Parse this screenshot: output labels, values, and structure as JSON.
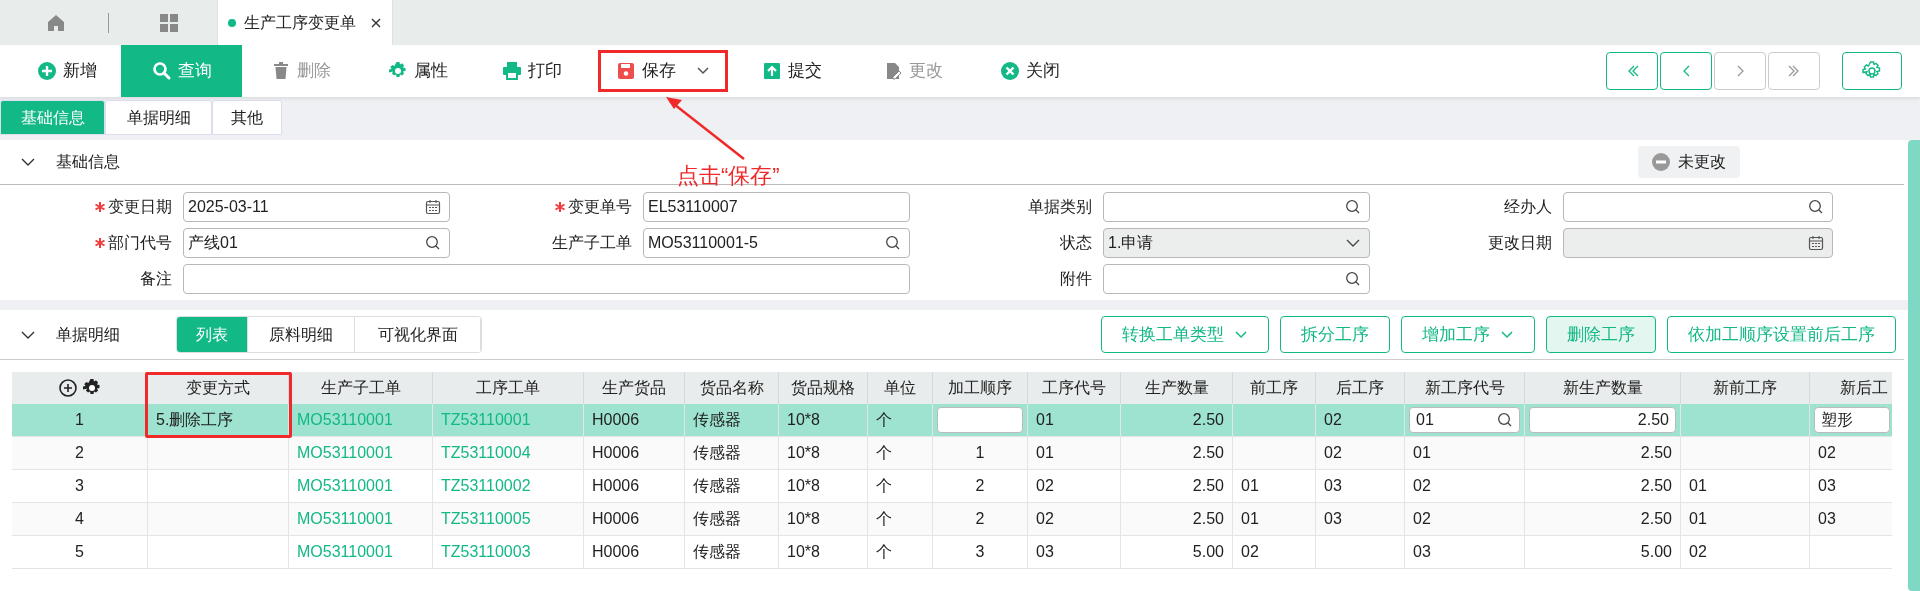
{
  "tabs": [
    {
      "kind": "home",
      "selected": false
    },
    {
      "kind": "grid",
      "selected": false
    },
    {
      "kind": "page",
      "label": "生产工序变更单",
      "selected": true,
      "closable": true
    }
  ],
  "toolbar": [
    {
      "label": "新增",
      "selected": false,
      "disabled": false
    },
    {
      "label": "查询",
      "selected": true,
      "disabled": false
    },
    {
      "label": "删除",
      "selected": false,
      "disabled": true
    },
    {
      "label": "属性",
      "selected": false,
      "disabled": false
    },
    {
      "label": "打印",
      "selected": false,
      "disabled": false
    },
    {
      "label": "保存",
      "selected": false,
      "disabled": false,
      "dropdown": true,
      "highlighted": true
    },
    {
      "label": "提交",
      "selected": false,
      "disabled": false
    },
    {
      "label": "更改",
      "selected": false,
      "disabled": true
    },
    {
      "label": "关闭",
      "selected": false,
      "disabled": false
    }
  ],
  "pager": [
    {
      "kind": "first",
      "disabled": false
    },
    {
      "kind": "prev",
      "disabled": false
    },
    {
      "kind": "next",
      "disabled": true
    },
    {
      "kind": "last",
      "disabled": true
    }
  ],
  "section_tabs": [
    {
      "label": "基础信息",
      "selected": true
    },
    {
      "label": "单据明细",
      "selected": false
    },
    {
      "label": "其他",
      "selected": false
    }
  ],
  "basic_info": {
    "title": "基础信息",
    "expanded": true,
    "status_badge": "未更改",
    "rows": [
      [
        {
          "label": "变更日期",
          "required": true,
          "kind": "date",
          "value": "2025-03-11",
          "disabled": false
        },
        {
          "label": "变更单号",
          "required": true,
          "kind": "text",
          "value": "EL53110007",
          "disabled": false
        },
        {
          "label": "单据类别",
          "required": false,
          "kind": "search",
          "disabled": false
        },
        {
          "label": "经办人",
          "required": false,
          "kind": "search",
          "disabled": false
        }
      ],
      [
        {
          "label": "部门代号",
          "required": true,
          "kind": "search",
          "value": "产线01",
          "disabled": false
        },
        {
          "label": "生产子工单",
          "required": false,
          "kind": "search",
          "value": "MO53110001-5",
          "disabled": false
        },
        {
          "label": "状态",
          "required": false,
          "kind": "select",
          "value": "1.申请",
          "disabled": true
        },
        {
          "label": "更改日期",
          "required": false,
          "kind": "date",
          "disabled": true
        }
      ],
      [
        {
          "label": "备注",
          "required": false,
          "kind": "text",
          "disabled": false
        },
        "",
        {
          "label": "附件",
          "required": false,
          "kind": "search",
          "disabled": false
        }
      ]
    ]
  },
  "callout": {
    "text": "点击“保存”"
  },
  "detail": {
    "title": "单据明细",
    "expanded": true,
    "views": [
      {
        "label": "列表",
        "selected": true
      },
      {
        "label": "原料明细",
        "selected": false
      },
      {
        "label": "可视化界面",
        "selected": false
      }
    ],
    "actions": [
      {
        "label": "转换工单类型",
        "dropdown": true,
        "selected": false
      },
      {
        "label": "拆分工序",
        "dropdown": false,
        "selected": false
      },
      {
        "label": "增加工序",
        "dropdown": true,
        "selected": false
      },
      {
        "label": "删除工序",
        "dropdown": false,
        "selected": true
      },
      {
        "label": "依加工顺序设置前后工序",
        "dropdown": false,
        "selected": false
      }
    ],
    "columns": [
      {
        "label": "变更方式",
        "kind": "text",
        "highlighted": true
      },
      {
        "label": "生产子工单",
        "kind": "link"
      },
      {
        "label": "工序工单",
        "kind": "link"
      },
      {
        "label": "生产货品",
        "kind": "text"
      },
      {
        "label": "货品名称",
        "kind": "text"
      },
      {
        "label": "货品规格",
        "kind": "text"
      },
      {
        "label": "单位",
        "kind": "text"
      },
      {
        "label": "加工顺序",
        "kind": "input"
      },
      {
        "label": "工序代号",
        "kind": "text"
      },
      {
        "label": "生产数量",
        "kind": "text"
      },
      {
        "label": "前工序",
        "kind": "text"
      },
      {
        "label": "后工序",
        "kind": "text"
      },
      {
        "label": "新工序代号",
        "kind": "search"
      },
      {
        "label": "新生产数量",
        "kind": "input"
      },
      {
        "label": "新前工序",
        "kind": "text"
      },
      {
        "label": "新后工",
        "kind": "input"
      }
    ],
    "rows": [
      {
        "index": "1",
        "selected": true,
        "cells": [
          "5.删除工序",
          "MO53110001",
          "TZ53110001",
          "H0006",
          "传感器",
          "10*8",
          "个",
          "",
          "01",
          "2.50",
          "",
          "02",
          "01",
          "2.50",
          "",
          "塑形"
        ]
      },
      {
        "index": "2",
        "selected": false,
        "cells": [
          "",
          "MO53110001",
          "TZ53110004",
          "H0006",
          "传感器",
          "10*8",
          "个",
          "1",
          "01",
          "2.50",
          "",
          "02",
          "01",
          "2.50",
          "",
          "02"
        ]
      },
      {
        "index": "3",
        "selected": false,
        "cells": [
          "",
          "MO53110001",
          "TZ53110002",
          "H0006",
          "传感器",
          "10*8",
          "个",
          "2",
          "02",
          "2.50",
          "01",
          "03",
          "02",
          "2.50",
          "01",
          "03"
        ]
      },
      {
        "index": "4",
        "selected": false,
        "cells": [
          "",
          "MO53110001",
          "TZ53110005",
          "H0006",
          "传感器",
          "10*8",
          "个",
          "2",
          "02",
          "2.50",
          "01",
          "03",
          "02",
          "2.50",
          "01",
          "03"
        ]
      },
      {
        "index": "5",
        "selected": false,
        "cells": [
          "",
          "MO53110001",
          "TZ53110003",
          "H0006",
          "传感器",
          "10*8",
          "个",
          "3",
          "03",
          "5.00",
          "02",
          "",
          "03",
          "5.00",
          "02",
          ""
        ]
      }
    ]
  }
}
